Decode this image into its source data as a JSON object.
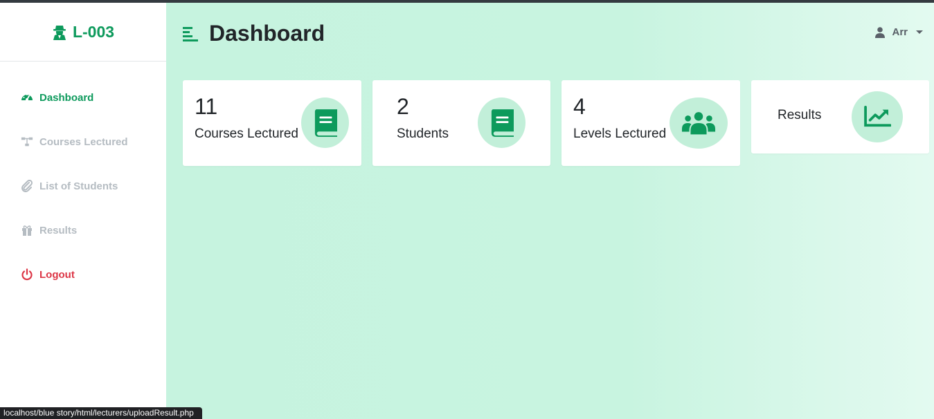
{
  "brand": {
    "title": "L-003",
    "icon": "user-secret-icon"
  },
  "sidebar": {
    "items": [
      {
        "label": "Dashboard",
        "icon": "tachometer-icon"
      },
      {
        "label": "Courses Lectured",
        "icon": "sitemap-icon"
      },
      {
        "label": "List of Students",
        "icon": "paperclip-icon"
      },
      {
        "label": "Results",
        "icon": "gift-icon"
      },
      {
        "label": "Logout",
        "icon": "power-icon"
      }
    ]
  },
  "header": {
    "title": "Dashboard",
    "user": "Arr"
  },
  "cards": [
    {
      "value": "11",
      "label": "Courses Lectured",
      "icon": "book-icon"
    },
    {
      "value": "2",
      "label": "Students",
      "icon": "book-icon"
    },
    {
      "value": "4",
      "label": "Levels Lectured",
      "icon": "users-icon"
    },
    {
      "value": "",
      "label": "Results",
      "icon": "chart-line-icon"
    }
  ],
  "status_url": "localhost/blue story/html/lecturers/uploadResult.php",
  "colors": {
    "accent": "#0d9a5c",
    "danger": "#dc3545",
    "background": "#c6f3df",
    "muted": "#b5bcc2"
  }
}
